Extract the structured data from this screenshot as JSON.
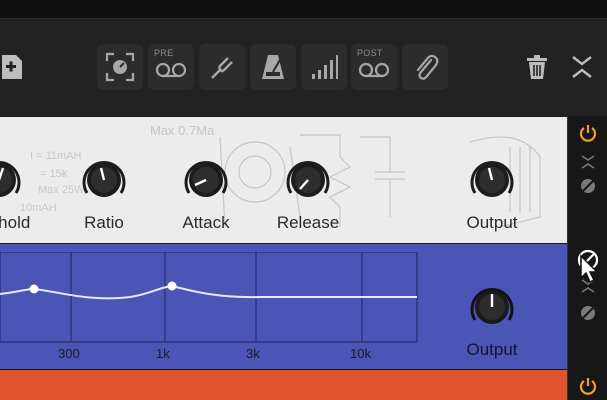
{
  "toolbar": {
    "buttons": [
      {
        "name": "snapshot-button",
        "icon": "focus-camera-icon",
        "label": ""
      },
      {
        "name": "pre-tape-button",
        "icon": "tape-icon",
        "label": "PRE"
      },
      {
        "name": "tuner-button",
        "icon": "tuning-fork-icon",
        "label": ""
      },
      {
        "name": "metronome-button",
        "icon": "metronome-icon",
        "label": ""
      },
      {
        "name": "levels-button",
        "icon": "signal-bars-icon",
        "label": ""
      },
      {
        "name": "post-tape-button",
        "icon": "tape-icon",
        "label": "POST"
      },
      {
        "name": "attach-button",
        "icon": "paperclip-icon",
        "label": ""
      }
    ],
    "pre_label": "PRE",
    "post_label": "POST"
  },
  "compressor": {
    "knobs": [
      {
        "label": "shold",
        "value": 0.55
      },
      {
        "label": "Ratio",
        "value": 0.45
      },
      {
        "label": "Attack",
        "value": 0.2
      },
      {
        "label": "Release",
        "value": 0.25
      },
      {
        "label": "Output",
        "value": 0.45
      }
    ]
  },
  "eq": {
    "freq_labels": [
      "300",
      "1k",
      "3k",
      "10k"
    ],
    "output_label": "Output",
    "output_value": 0.7
  },
  "colors": {
    "accent": "#f0a020",
    "eq_panel": "#4a55b5",
    "comp_panel": "#ececec",
    "next_panel": "#e0532d"
  }
}
